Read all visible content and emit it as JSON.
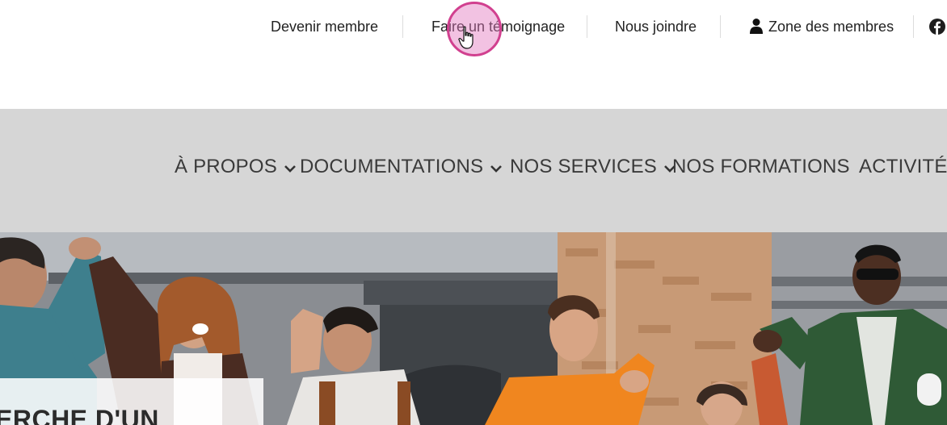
{
  "topbar": {
    "links": [
      {
        "label": "Devenir membre"
      },
      {
        "label": "Faire un témoignage"
      },
      {
        "label": "Nous joindre"
      },
      {
        "label": "Zone des membres",
        "icon": "user-icon"
      }
    ],
    "social_icon": "facebook-icon"
  },
  "mainnav": {
    "items": [
      {
        "label": "À PROPOS",
        "has_dropdown": true
      },
      {
        "label": "DOCUMENTATIONS",
        "has_dropdown": true
      },
      {
        "label": "NOS SERVICES",
        "has_dropdown": true
      },
      {
        "label": "NOS FORMATIONS",
        "has_dropdown": false
      },
      {
        "label": "ACTIVITÉS",
        "has_dropdown": false
      }
    ]
  },
  "hero": {
    "title_partial": "ERCHE D'UN"
  },
  "colors": {
    "nav_bg": "#d6d6d6",
    "click_ring": "#d1408f",
    "text": "#222222"
  }
}
